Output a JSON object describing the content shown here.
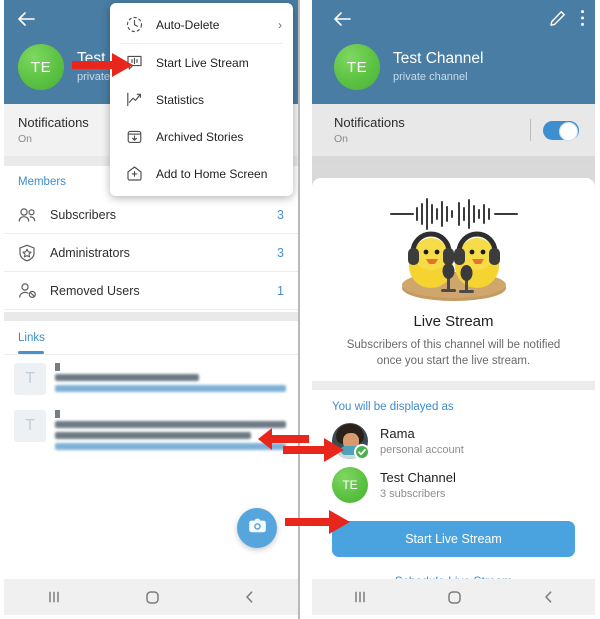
{
  "left_panel": {
    "header": {
      "back_icon": "back-arrow-icon",
      "avatar_initials": "TE",
      "channel_name": "Test Channel",
      "channel_subtitle": "private channel"
    },
    "notifications": {
      "title": "Notifications",
      "state": "On"
    },
    "menu": {
      "items": [
        {
          "label": "Auto-Delete",
          "icon": "auto-delete-clock-icon",
          "chevron": "›"
        },
        {
          "label": "Start Live Stream",
          "icon": "live-stream-icon",
          "chevron": ""
        },
        {
          "label": "Statistics",
          "icon": "statistics-chart-icon",
          "chevron": ""
        },
        {
          "label": "Archived Stories",
          "icon": "archive-box-icon",
          "chevron": ""
        },
        {
          "label": "Add to Home Screen",
          "icon": "add-home-screen-icon",
          "chevron": ""
        }
      ]
    },
    "members": {
      "section_title": "Members",
      "rows": [
        {
          "label": "Subscribers",
          "count": "3",
          "icon": "two-people-icon"
        },
        {
          "label": "Administrators",
          "count": "3",
          "icon": "shield-star-icon"
        },
        {
          "label": "Removed Users",
          "count": "1",
          "icon": "person-blocked-icon"
        }
      ]
    },
    "links": {
      "tab_label": "Links",
      "items": [
        {
          "thumb_letter": "T",
          "redacted": true
        },
        {
          "thumb_letter": "T",
          "redacted": true
        }
      ]
    },
    "fab": {
      "icon": "camera-icon"
    },
    "navbar": {
      "recents": "recents-icon",
      "home": "home-icon",
      "back": "back-icon"
    }
  },
  "right_panel": {
    "header": {
      "back_icon": "back-arrow-icon",
      "edit_icon": "pencil-edit-icon",
      "overflow_icon": "more-vertical-icon",
      "avatar_initials": "TE",
      "channel_name": "Test Channel",
      "channel_subtitle": "private channel"
    },
    "notifications": {
      "title": "Notifications",
      "state": "On",
      "toggle_on": true
    },
    "hero": {
      "illustration": "two-ducks-with-headphones-and-microphones-illustration",
      "title": "Live Stream",
      "description": "Subscribers of this channel will be notified once you start the live stream."
    },
    "displayed_as": {
      "section_title": "You will be displayed as",
      "accounts": [
        {
          "name": "Rama",
          "subtitle": "personal account",
          "avatar_type": "photo",
          "selected": true
        },
        {
          "name": "Test Channel",
          "subtitle": "3 subscribers",
          "avatar_type": "initials",
          "avatar_initials": "TE",
          "selected": false
        }
      ]
    },
    "actions": {
      "primary_label": "Start Live Stream",
      "secondary_label": "Schedule Live Stream"
    },
    "navbar": {
      "recents": "recents-icon",
      "home": "home-icon",
      "back": "back-icon"
    }
  },
  "annotations": {
    "arrows": [
      {
        "name": "arrow-to-start-live-stream-menu-item"
      },
      {
        "name": "arrow-to-link-text"
      },
      {
        "name": "arrow-to-test-channel-account"
      },
      {
        "name": "arrow-to-start-live-stream-button"
      }
    ],
    "color": "#e8261c"
  },
  "colors": {
    "header_blue": "#4a7da3",
    "accent_blue": "#3e8ccb",
    "button_blue": "#4aa3df",
    "avatar_green": "#5cc243",
    "arrow_red": "#e8261c"
  }
}
